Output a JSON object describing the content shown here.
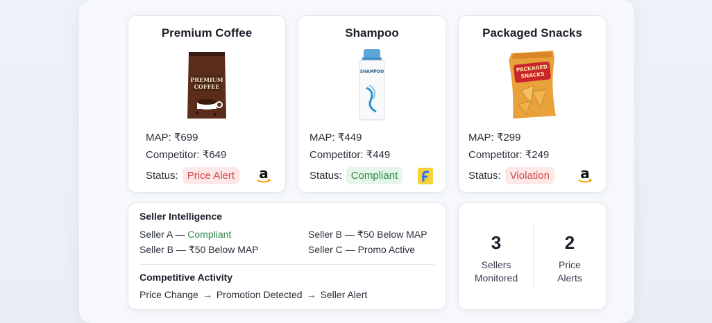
{
  "products": [
    {
      "title": "Premium Coffee",
      "map_label": "MAP:",
      "map_value": "₹699",
      "competitor_label": "Competitor:",
      "competitor_value": "₹649",
      "status_label": "Status:",
      "status_value": "Price Alert",
      "store_icon": "amazon-icon",
      "package_text": "PREMIUM COFFEE"
    },
    {
      "title": "Shampoo",
      "map_label": "MAP:",
      "map_value": "₹449",
      "competitor_label": "Competitor:",
      "competitor_value": "₹449",
      "status_label": "Status:",
      "status_value": "Compliant",
      "store_icon": "flipkart-icon",
      "package_text": "SHAMPOO"
    },
    {
      "title": "Packaged Snacks",
      "map_label": "MAP:",
      "map_value": "₹299",
      "competitor_label": "Competitor:",
      "competitor_value": "₹249",
      "status_label": "Status:",
      "status_value": "Violation",
      "store_icon": "amazon-icon",
      "package_text": "PACKAGED SNACKS"
    }
  ],
  "intel": {
    "title": "Seller Intelligence",
    "row1_left_prefix": "Seller A — ",
    "row1_left_status": "Compliant",
    "row1_right": "Seller B — ₹50 Below MAP",
    "row2_left": "Seller B — ₹50 Below MAP",
    "row2_right": "Seller C — Promo Active",
    "activity_title": "Competitive Activity",
    "flow": [
      "Price Change",
      "Promotion Detected",
      "Seller Alert"
    ]
  },
  "stats": [
    {
      "value": "3",
      "label_line1": "Sellers",
      "label_line2": "Monitored"
    },
    {
      "value": "2",
      "label_line1": "Price",
      "label_line2": "Alerts"
    }
  ],
  "colors": {
    "alert_bg": "#fde8e8",
    "alert_text": "#d04a4a",
    "ok_bg": "#e6f5ea",
    "ok_text": "#2f8a4a"
  }
}
